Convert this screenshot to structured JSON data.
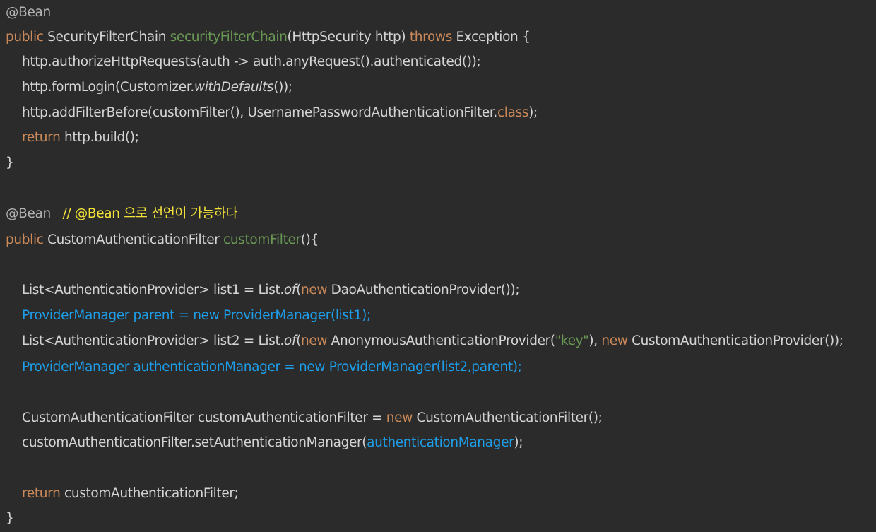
{
  "editor": {
    "language": "java",
    "colors": {
      "background": "#2b2b2b",
      "keyword": "#cc8a5a",
      "method_decl": "#6a9955",
      "comment": "#f2e23a",
      "highlight": "#1e9ee8",
      "text": "#d4d4d4"
    },
    "lines": [
      {
        "indent": false,
        "tokens": [
          {
            "t": "@Bean",
            "c": "ann"
          }
        ]
      },
      {
        "indent": false,
        "tokens": [
          {
            "t": "public",
            "c": "kw"
          },
          {
            "t": " SecurityFilterChain ",
            "c": "plain"
          },
          {
            "t": "securityFilterChain",
            "c": "fn"
          },
          {
            "t": "(HttpSecurity http) ",
            "c": "plain"
          },
          {
            "t": "throws",
            "c": "kw"
          },
          {
            "t": " Exception {",
            "c": "plain"
          }
        ]
      },
      {
        "indent": true,
        "tokens": [
          {
            "t": "http.authorizeHttpRequests(auth -> auth.anyRequest().authenticated());",
            "c": "plain"
          }
        ]
      },
      {
        "indent": true,
        "tokens": [
          {
            "t": "http.formLogin(Customizer.",
            "c": "plain"
          },
          {
            "t": "withDefaults",
            "c": "plain italic"
          },
          {
            "t": "());",
            "c": "plain"
          }
        ]
      },
      {
        "indent": true,
        "tokens": [
          {
            "t": "http.addFilterBefore(customFilter(), UsernamePasswordAuthenticationFilter.",
            "c": "plain"
          },
          {
            "t": "class",
            "c": "kw"
          },
          {
            "t": ");",
            "c": "plain"
          }
        ]
      },
      {
        "indent": true,
        "tokens": [
          {
            "t": "return",
            "c": "kw"
          },
          {
            "t": " http.build();",
            "c": "plain"
          }
        ]
      },
      {
        "indent": false,
        "tokens": [
          {
            "t": "}",
            "c": "plain"
          }
        ]
      },
      {
        "indent": false,
        "tokens": []
      },
      {
        "indent": false,
        "tokens": [
          {
            "t": "@Bean",
            "c": "ann"
          },
          {
            "t": "   ",
            "c": "plain"
          },
          {
            "t": "// @Bean 으로 선언이 가능하다",
            "c": "comment"
          }
        ]
      },
      {
        "indent": false,
        "tokens": [
          {
            "t": "public",
            "c": "kw"
          },
          {
            "t": " CustomAuthenticationFilter ",
            "c": "plain"
          },
          {
            "t": "customFilter",
            "c": "fn"
          },
          {
            "t": "(){",
            "c": "plain"
          }
        ]
      },
      {
        "indent": false,
        "tokens": []
      },
      {
        "indent": true,
        "tokens": [
          {
            "t": "List<AuthenticationProvider> list1 = List.",
            "c": "plain"
          },
          {
            "t": "of",
            "c": "plain italic"
          },
          {
            "t": "(",
            "c": "plain"
          },
          {
            "t": "new",
            "c": "kw"
          },
          {
            "t": " DaoAuthenticationProvider());",
            "c": "plain"
          }
        ]
      },
      {
        "indent": true,
        "tokens": [
          {
            "t": "ProviderManager parent = new ProviderManager(list1);",
            "c": "blue"
          }
        ]
      },
      {
        "indent": true,
        "tokens": [
          {
            "t": "List<AuthenticationProvider> list2 = List.",
            "c": "plain"
          },
          {
            "t": "of",
            "c": "plain italic"
          },
          {
            "t": "(",
            "c": "plain"
          },
          {
            "t": "new",
            "c": "kw"
          },
          {
            "t": " AnonymousAuthenticationProvider(",
            "c": "plain"
          },
          {
            "t": "\"key\"",
            "c": "string"
          },
          {
            "t": "), ",
            "c": "plain"
          },
          {
            "t": "new",
            "c": "kw"
          },
          {
            "t": " CustomAuthenticationProvider());",
            "c": "plain"
          }
        ]
      },
      {
        "indent": true,
        "tokens": [
          {
            "t": "ProviderManager authenticationManager = new ProviderManager(list2,parent);",
            "c": "blue"
          }
        ]
      },
      {
        "indent": false,
        "tokens": []
      },
      {
        "indent": true,
        "tokens": [
          {
            "t": "CustomAuthenticationFilter customAuthenticationFilter = ",
            "c": "plain"
          },
          {
            "t": "new",
            "c": "kw"
          },
          {
            "t": " CustomAuthenticationFilter();",
            "c": "plain"
          }
        ]
      },
      {
        "indent": true,
        "tokens": [
          {
            "t": "customAuthenticationFilter.setAuthenticationManager(",
            "c": "plain"
          },
          {
            "t": "authenticationManager",
            "c": "blue"
          },
          {
            "t": ");",
            "c": "plain"
          }
        ]
      },
      {
        "indent": false,
        "tokens": []
      },
      {
        "indent": true,
        "tokens": [
          {
            "t": "return",
            "c": "kw"
          },
          {
            "t": " customAuthenticationFilter;",
            "c": "plain"
          }
        ]
      },
      {
        "indent": false,
        "tokens": [
          {
            "t": "}",
            "c": "plain"
          }
        ]
      }
    ]
  }
}
